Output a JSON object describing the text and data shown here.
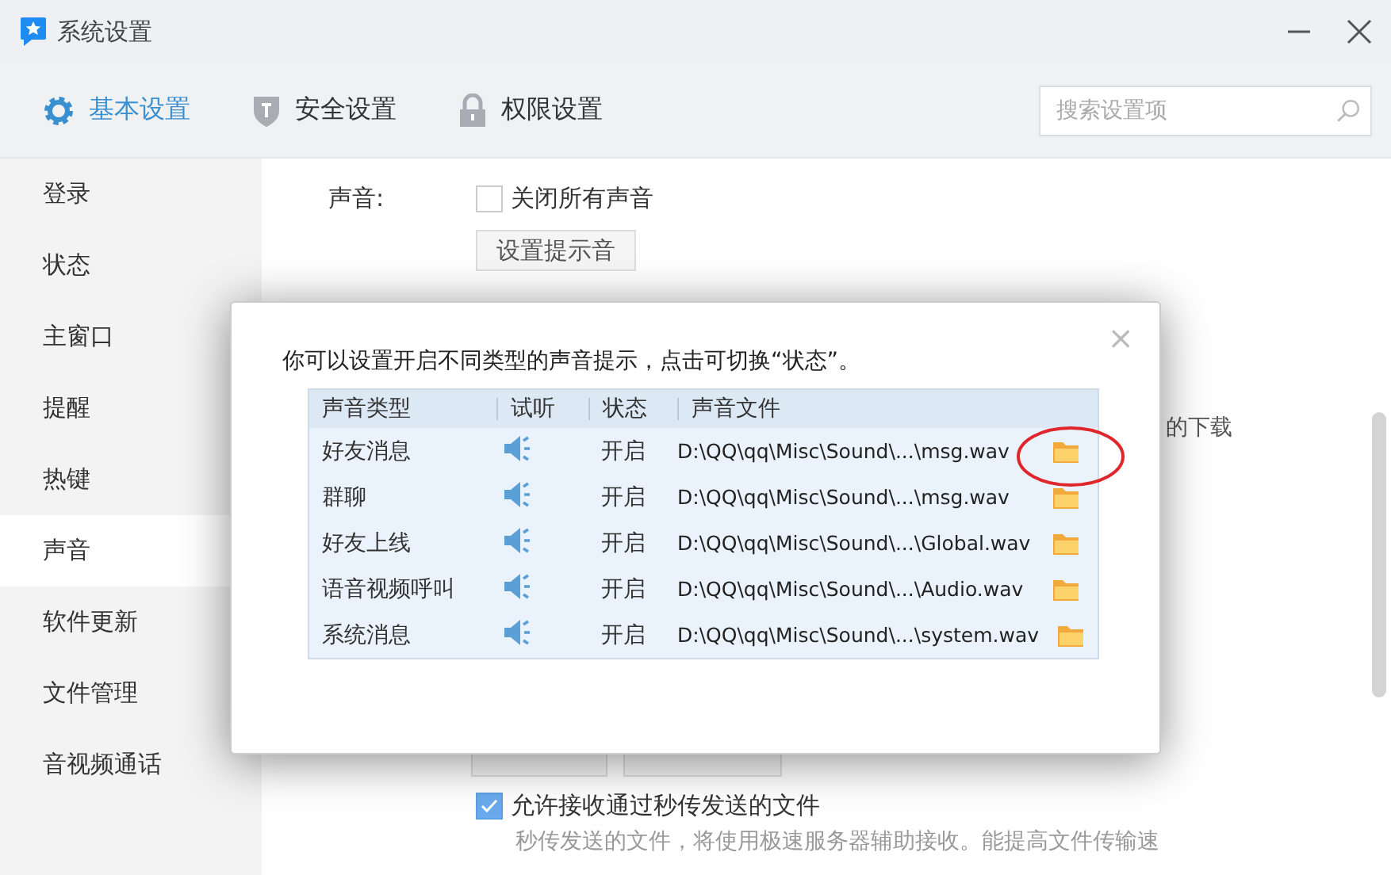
{
  "window": {
    "title": "系统设置"
  },
  "tabs": [
    {
      "label": "基本设置",
      "selected": true,
      "kind": "gear"
    },
    {
      "label": "安全设置",
      "selected": false,
      "kind": "shield"
    },
    {
      "label": "权限设置",
      "selected": false,
      "kind": "lock"
    }
  ],
  "search": {
    "placeholder": "搜索设置项"
  },
  "sidebar": {
    "items": [
      {
        "label": "登录",
        "selected": false
      },
      {
        "label": "状态",
        "selected": false
      },
      {
        "label": "主窗口",
        "selected": false
      },
      {
        "label": "提醒",
        "selected": false
      },
      {
        "label": "热键",
        "selected": false
      },
      {
        "label": "声音",
        "selected": true
      },
      {
        "label": "软件更新",
        "selected": false
      },
      {
        "label": "文件管理",
        "selected": false
      },
      {
        "label": "音视频通话",
        "selected": false
      }
    ]
  },
  "sound": {
    "label": "声音:",
    "mute_all": {
      "label": "关闭所有声音",
      "checked": false
    },
    "set_button": "设置提示音"
  },
  "download": {
    "fragment": "的下载"
  },
  "instant_transfer": {
    "label": "允许接收通过秒传发送的文件",
    "checked": true,
    "hint": "秒传发送的文件，将使用极速服务器辅助接收。能提高文件传输速"
  },
  "dialog": {
    "close": "×",
    "message": "你可以设置开启不同类型的声音提示，点击可切换“状态”。",
    "columns": [
      "声音类型",
      "试听",
      "状态",
      "声音文件"
    ],
    "rows": [
      {
        "type": "好友消息",
        "status": "开启",
        "file": "D:\\QQ\\qq\\Misc\\Sound\\...\\msg.wav",
        "circled": true
      },
      {
        "type": "群聊",
        "status": "开启",
        "file": "D:\\QQ\\qq\\Misc\\Sound\\...\\msg.wav",
        "circled": false
      },
      {
        "type": "好友上线",
        "status": "开启",
        "file": "D:\\QQ\\qq\\Misc\\Sound\\...\\Global.wav",
        "circled": false
      },
      {
        "type": "语音视频呼叫",
        "status": "开启",
        "file": "D:\\QQ\\qq\\Misc\\Sound\\...\\Audio.wav",
        "circled": false
      },
      {
        "type": "系统消息",
        "status": "开启",
        "file": "D:\\QQ\\qq\\Misc\\Sound\\...\\system.wav",
        "circled": false
      }
    ]
  }
}
